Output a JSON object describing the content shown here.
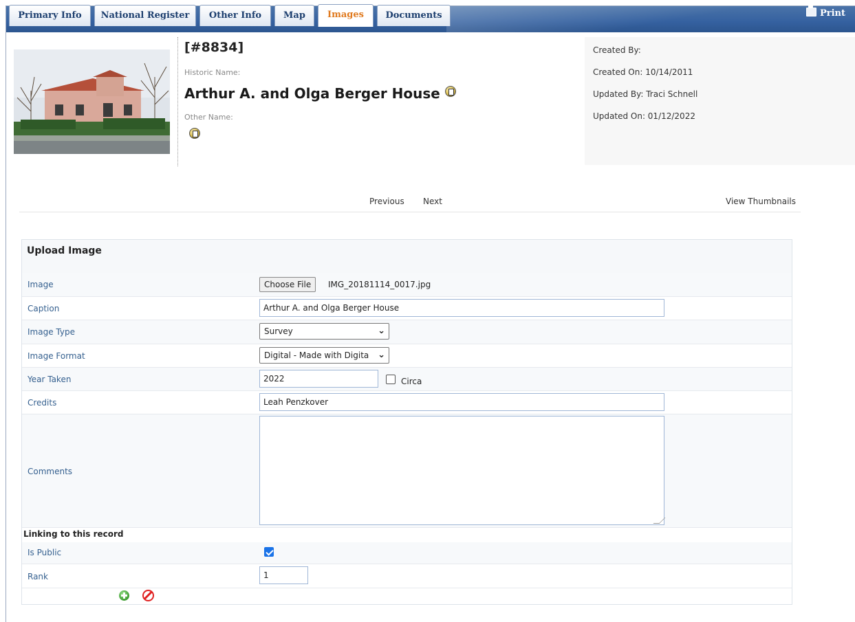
{
  "tabs": [
    {
      "label": "Primary Info",
      "active": false
    },
    {
      "label": "National Register",
      "active": false
    },
    {
      "label": "Other Info",
      "active": false
    },
    {
      "label": "Map",
      "active": false
    },
    {
      "label": "Images",
      "active": true
    },
    {
      "label": "Documents",
      "active": false
    }
  ],
  "print_label": "Print",
  "header": {
    "record_id": "[#8834]",
    "historic_name_label": "Historic Name:",
    "historic_name": "Arthur A. and Olga Berger House",
    "other_name_label": "Other Name:",
    "created_by": "Created By:",
    "created_on": "Created On:  10/14/2011",
    "updated_by": "Updated By:  Traci Schnell",
    "updated_on": "Updated On:  01/12/2022"
  },
  "nav": {
    "previous": "Previous",
    "next": "Next",
    "view_thumbnails": "View Thumbnails"
  },
  "form": {
    "title": "Upload Image",
    "image_label": "Image",
    "choose_file": "Choose File",
    "file_name": "IMG_20181114_0017.jpg",
    "caption_label": "Caption",
    "caption_value": "Arthur A. and Olga Berger House",
    "image_type_label": "Image Type",
    "image_type_value": "Survey",
    "image_format_label": "Image Format",
    "image_format_value": "Digital - Made with Digita",
    "year_label": "Year Taken",
    "year_value": "2022",
    "circa_label": "Circa",
    "circa_checked": false,
    "credits_label": "Credits",
    "credits_value": "Leah Penzkover",
    "comments_label": "Comments",
    "comments_value": "",
    "linking_label": "Linking to this record",
    "is_public_label": "Is Public",
    "is_public_checked": true,
    "rank_label": "Rank",
    "rank_value": "1"
  },
  "icons": {
    "edit": "edit-icon",
    "add": "add-icon",
    "cancel": "cancel-icon",
    "print": "printer-icon"
  }
}
